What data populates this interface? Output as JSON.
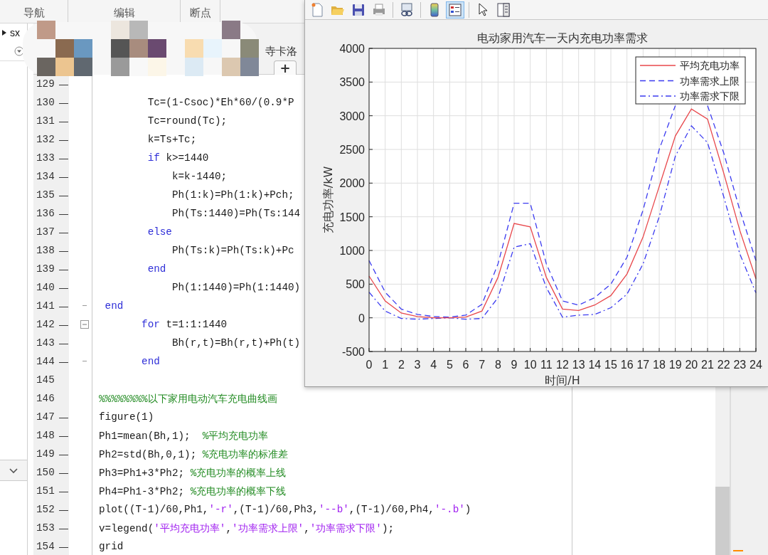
{
  "editor_toolbar": {
    "sections": [
      "导航",
      "编辑",
      "断点"
    ]
  },
  "file_browser": {
    "folder": "sx"
  },
  "editor_tabs": {
    "tab_label": "寺卡洛",
    "new_tab": "+"
  },
  "code_lines": [
    {
      "number": "129",
      "marker": "—"
    },
    {
      "number": "130",
      "marker": "—",
      "segments": [
        {
          "kind": "code",
          "text": "        Tc=(1-Csoc)*Eh*60/(0.9*P"
        }
      ]
    },
    {
      "number": "131",
      "marker": "—",
      "segments": [
        {
          "kind": "code",
          "text": "        Tc=round(Tc);"
        }
      ]
    },
    {
      "number": "132",
      "marker": "—",
      "segments": [
        {
          "kind": "code",
          "text": "        k=Ts+Tc;"
        }
      ]
    },
    {
      "number": "133",
      "marker": "—",
      "segments": [
        {
          "kind": "keyword",
          "text": "        if"
        },
        {
          "kind": "code",
          "text": " k>=1440"
        }
      ]
    },
    {
      "number": "134",
      "marker": "—",
      "segments": [
        {
          "kind": "code",
          "text": "            k=k-1440;"
        }
      ]
    },
    {
      "number": "135",
      "marker": "—",
      "segments": [
        {
          "kind": "code",
          "text": "            Ph(1:k)=Ph(1:k)+Pch;"
        }
      ]
    },
    {
      "number": "136",
      "marker": "—",
      "segments": [
        {
          "kind": "code",
          "text": "            Ph(Ts:1440)=Ph(Ts:144"
        }
      ]
    },
    {
      "number": "137",
      "marker": "—",
      "segments": [
        {
          "kind": "keyword",
          "text": "        else"
        }
      ]
    },
    {
      "number": "138",
      "marker": "—",
      "segments": [
        {
          "kind": "code",
          "text": "            Ph(Ts:k)=Ph(Ts:k)+Pc"
        }
      ]
    },
    {
      "number": "139",
      "marker": "—",
      "segments": [
        {
          "kind": "keyword",
          "text": "        end"
        }
      ]
    },
    {
      "number": "140",
      "marker": "—",
      "segments": [
        {
          "kind": "code",
          "text": "            Ph(1:1440)=Ph(1:1440)"
        }
      ]
    },
    {
      "number": "141",
      "marker": "—",
      "block_end": true,
      "segments": [
        {
          "kind": "keyword",
          "text": " end"
        }
      ]
    },
    {
      "number": "142",
      "marker": "—",
      "fold_toggle": true,
      "segments": [
        {
          "kind": "keyword",
          "text": "       for"
        },
        {
          "kind": "code",
          "text": " t=1:1:1440"
        }
      ]
    },
    {
      "number": "143",
      "marker": "—",
      "segments": [
        {
          "kind": "code",
          "text": "            Bh(r,t)=Bh(r,t)+Ph(t)"
        }
      ]
    },
    {
      "number": "144",
      "marker": "—",
      "block_end": true,
      "segments": [
        {
          "kind": "keyword",
          "text": "       end"
        }
      ]
    },
    {
      "number": "145"
    },
    {
      "number": "146",
      "segments": [
        {
          "kind": "comment",
          "text": "%%%%%%%%以下家用电动汽车充电曲线画"
        }
      ]
    },
    {
      "number": "147",
      "marker": "—",
      "segments": [
        {
          "kind": "code",
          "text": "figure(1)"
        }
      ]
    },
    {
      "number": "148",
      "marker": "—",
      "segments": [
        {
          "kind": "code",
          "text": "Ph1=mean(Bh,1);  "
        },
        {
          "kind": "comment",
          "text": "%平均充电功率"
        }
      ]
    },
    {
      "number": "149",
      "marker": "—",
      "segments": [
        {
          "kind": "code",
          "text": "Ph2=std(Bh,0,1); "
        },
        {
          "kind": "comment",
          "text": "%充电功率的标准差"
        }
      ]
    },
    {
      "number": "150",
      "marker": "—",
      "segments": [
        {
          "kind": "code",
          "text": "Ph3=Ph1+3*Ph2; "
        },
        {
          "kind": "comment",
          "text": "%充电功率的概率上线"
        }
      ]
    },
    {
      "number": "151",
      "marker": "—",
      "segments": [
        {
          "kind": "code",
          "text": "Ph4=Ph1-3*Ph2; "
        },
        {
          "kind": "comment",
          "text": "%充电功率的概率下线"
        }
      ]
    },
    {
      "number": "152",
      "marker": "—",
      "segments": [
        {
          "kind": "code",
          "text": "plot((T-1)/60,Ph1,"
        },
        {
          "kind": "string",
          "text": "'-r'"
        },
        {
          "kind": "code",
          "text": ",(T-1)/60,Ph3,"
        },
        {
          "kind": "string",
          "text": "'--b'"
        },
        {
          "kind": "code",
          "text": ",(T-1)/60,Ph4,"
        },
        {
          "kind": "string",
          "text": "'-.b'"
        },
        {
          "kind": "code",
          "text": ")"
        }
      ]
    },
    {
      "number": "153",
      "marker": "—",
      "segments": [
        {
          "kind": "code",
          "text": "v=legend("
        },
        {
          "kind": "string",
          "text": "'平均充电功率'"
        },
        {
          "kind": "code",
          "text": ","
        },
        {
          "kind": "string",
          "text": "'功率需求上限'"
        },
        {
          "kind": "code",
          "text": ","
        },
        {
          "kind": "string",
          "text": "'功率需求下限'"
        },
        {
          "kind": "code",
          "text": ");"
        }
      ]
    },
    {
      "number": "154",
      "marker": "—",
      "segments": [
        {
          "kind": "code",
          "text": "grid"
        }
      ]
    }
  ],
  "figure": {
    "toolbar": [
      {
        "kind": "new",
        "selected": false
      },
      {
        "kind": "open",
        "selected": false
      },
      {
        "kind": "save",
        "selected": false
      },
      {
        "kind": "print",
        "selected": false
      },
      {
        "kind": "link",
        "selected": false
      },
      {
        "kind": "colorbar",
        "selected": false
      },
      {
        "kind": "legend",
        "selected": true
      },
      {
        "kind": "pointer",
        "selected": false
      },
      {
        "kind": "panel",
        "selected": false
      }
    ],
    "chart_data": {
      "type": "line",
      "title": "电动家用汽车一天内充电功率需求",
      "xlabel": "时间/H",
      "ylabel": "充电功率/kW",
      "grid": true,
      "legend": true,
      "x": [
        0,
        1,
        2,
        3,
        4,
        5,
        6,
        7,
        8,
        9,
        10,
        11,
        12,
        13,
        14,
        15,
        16,
        17,
        18,
        19,
        20,
        21,
        22,
        23,
        24
      ],
      "series": [
        {
          "name": "平均充电功率",
          "color": "#e8474b",
          "line_style": "solid",
          "values": [
            620,
            250,
            70,
            20,
            0,
            0,
            10,
            100,
            600,
            1400,
            1350,
            600,
            130,
            110,
            190,
            330,
            650,
            1200,
            1950,
            2700,
            3100,
            2950,
            2150,
            1300,
            580
          ]
        },
        {
          "name": "功率需求上限",
          "color": "#3b3bf0",
          "line_style": "dashed",
          "values": [
            850,
            380,
            130,
            50,
            20,
            10,
            40,
            200,
            800,
            1700,
            1700,
            800,
            250,
            190,
            300,
            500,
            900,
            1600,
            2500,
            3150,
            null,
            3150,
            2450,
            1600,
            850
          ]
        },
        {
          "name": "功率需求下限",
          "color": "#3b3bf0",
          "line_style": "dashdot",
          "values": [
            380,
            100,
            -10,
            -20,
            -10,
            0,
            -20,
            -10,
            300,
            1050,
            1100,
            450,
            10,
            40,
            50,
            150,
            350,
            800,
            1500,
            2400,
            2850,
            2600,
            1800,
            950,
            370
          ]
        }
      ],
      "xlim": [
        0,
        24
      ],
      "ylim": [
        -500,
        4000
      ],
      "xticks": [
        0,
        1,
        2,
        3,
        4,
        5,
        6,
        7,
        8,
        9,
        10,
        11,
        12,
        13,
        14,
        15,
        16,
        17,
        18,
        19,
        20,
        21,
        22,
        23,
        24
      ],
      "yticks": [
        -500,
        0,
        500,
        1000,
        1500,
        2000,
        2500,
        3000,
        3500,
        4000
      ]
    }
  }
}
